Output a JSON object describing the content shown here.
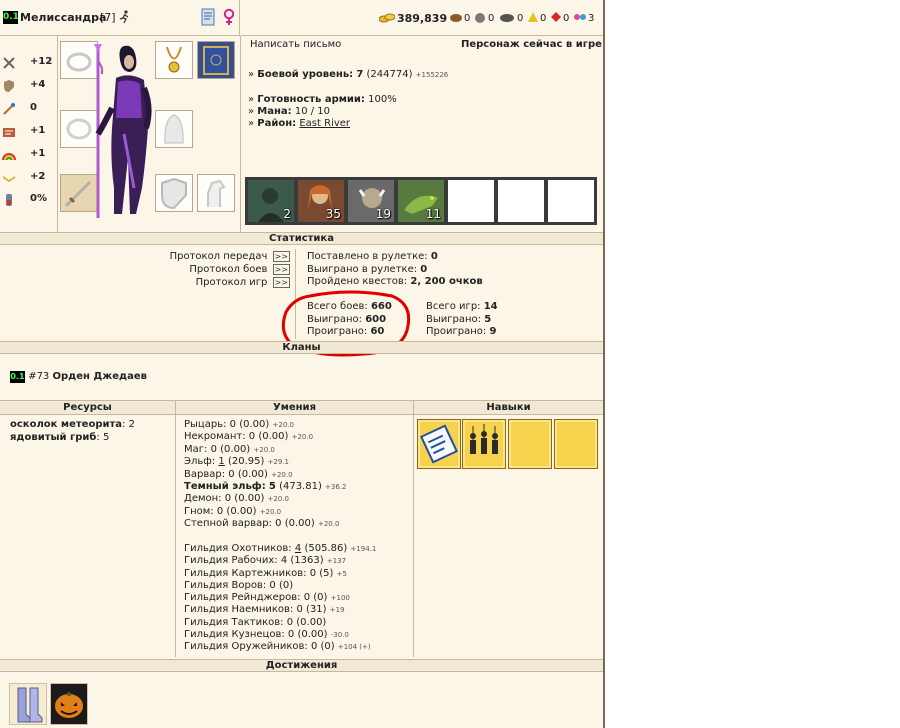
{
  "header": {
    "level_badge": "0.1",
    "name": "Мелиссандра",
    "level": "[7]",
    "gold": "389,839",
    "resources": [
      "0",
      "0",
      "0",
      "0",
      "0",
      "3"
    ]
  },
  "stats": [
    {
      "icon": "attack-icon",
      "value": "+12"
    },
    {
      "icon": "defense-icon",
      "value": "+4"
    },
    {
      "icon": "spellpower-icon",
      "value": "0"
    },
    {
      "icon": "knowledge-icon",
      "value": "+1"
    },
    {
      "icon": "luck-icon",
      "value": "+1"
    },
    {
      "icon": "morale-icon",
      "value": "+2"
    },
    {
      "icon": "initiative-icon",
      "value": "0%"
    }
  ],
  "info": {
    "write_letter": "Написать письмо",
    "online_status": "Персонаж сейчас в игре",
    "combat_level_label": "Боевой уровень:",
    "combat_level": "7",
    "combat_exp": "(244774)",
    "combat_exp_plus": "+155226",
    "army_ready_label": "Готовность армии:",
    "army_ready": "100%",
    "mana_label": "Мана:",
    "mana": "10 / 10",
    "district_label": "Район:",
    "district": "East River"
  },
  "army": [
    "2",
    "35",
    "19",
    "11",
    "",
    "",
    ""
  ],
  "statistics": {
    "title": "Статистика",
    "protocols": [
      {
        "label": "Протокол передач",
        "btn": ">>"
      },
      {
        "label": "Протокол боев",
        "btn": ">>"
      },
      {
        "label": "Протокол игр",
        "btn": ">>"
      }
    ],
    "roulette_bet_label": "Поставлено в рулетке:",
    "roulette_bet": "0",
    "roulette_won_label": "Выиграно в рулетке:",
    "roulette_won": "0",
    "quests_label": "Пройдено квестов:",
    "quests": "2, 200 очков",
    "battles_total_label": "Всего боев:",
    "battles_total": "660",
    "battles_won_label": "Выиграно:",
    "battles_won": "600",
    "battles_lost_label": "Проиграно:",
    "battles_lost": "60",
    "games_total_label": "Всего игр:",
    "games_total": "14",
    "games_won_label": "Выиграно:",
    "games_won": "5",
    "games_lost_label": "Проиграно:",
    "games_lost": "9"
  },
  "clans": {
    "title": "Кланы",
    "badge": "0.1",
    "number": "#73",
    "name": "Орден Джедаев"
  },
  "resources_section": {
    "title": "Ресурсы",
    "items": [
      {
        "name": "осколок метеорита",
        "count": "2"
      },
      {
        "name": "ядовитый гриб",
        "count": "5"
      }
    ]
  },
  "skills_section": {
    "title": "Умения",
    "factions": [
      {
        "name": "Рыцарь:",
        "level": "0",
        "points": "(0.00)",
        "plus": "+20.0",
        "bold": false
      },
      {
        "name": "Некромант:",
        "level": "0",
        "points": "(0.00)",
        "plus": "+20.0",
        "bold": false
      },
      {
        "name": "Маг:",
        "level": "0",
        "points": "(0.00)",
        "plus": "+20.0",
        "bold": false
      },
      {
        "name": "Эльф:",
        "level": "1",
        "points": "(20.95)",
        "plus": "+29.1",
        "bold": false
      },
      {
        "name": "Варвар:",
        "level": "0",
        "points": "(0.00)",
        "plus": "+20.0",
        "bold": false
      },
      {
        "name": "Темный эльф:",
        "level": "5",
        "points": "(473.81)",
        "plus": "+36.2",
        "bold": true
      },
      {
        "name": "Демон:",
        "level": "0",
        "points": "(0.00)",
        "plus": "+20.0",
        "bold": false
      },
      {
        "name": "Гном:",
        "level": "0",
        "points": "(0.00)",
        "plus": "+20.0",
        "bold": false
      },
      {
        "name": "Степной варвар:",
        "level": "0",
        "points": "(0.00)",
        "plus": "+20.0",
        "bold": false
      }
    ],
    "guilds": [
      {
        "name": "Гильдия Охотников:",
        "level": "4",
        "points": "(505.86)",
        "plus": "+194.1"
      },
      {
        "name": "Гильдия Рабочих:",
        "level": "4",
        "points": "(1363)",
        "plus": "+137"
      },
      {
        "name": "Гильдия Картежников:",
        "level": "0",
        "points": "(5)",
        "plus": "+5"
      },
      {
        "name": "Гильдия Воров:",
        "level": "0",
        "points": "(0)",
        "plus": ""
      },
      {
        "name": "Гильдия Рейнджеров:",
        "level": "0",
        "points": "(0)",
        "plus": "+100"
      },
      {
        "name": "Гильдия Наемников:",
        "level": "0",
        "points": "(31)",
        "plus": "+19"
      },
      {
        "name": "Гильдия Тактиков:",
        "level": "0",
        "points": "(0.00)",
        "plus": ""
      },
      {
        "name": "Гильдия Кузнецов:",
        "level": "0",
        "points": "(0.00)",
        "plus": "-30.0"
      },
      {
        "name": "Гильдия Оружейников:",
        "level": "0",
        "points": "(0)",
        "plus": "+104 (+)"
      }
    ]
  },
  "talents_section": {
    "title": "Навыки"
  },
  "achievements": {
    "title": "Достижения"
  },
  "colors": {
    "background": "#fcf6e8",
    "highlight_circle": "#e00000",
    "skill_gold": "#f7d24c"
  }
}
